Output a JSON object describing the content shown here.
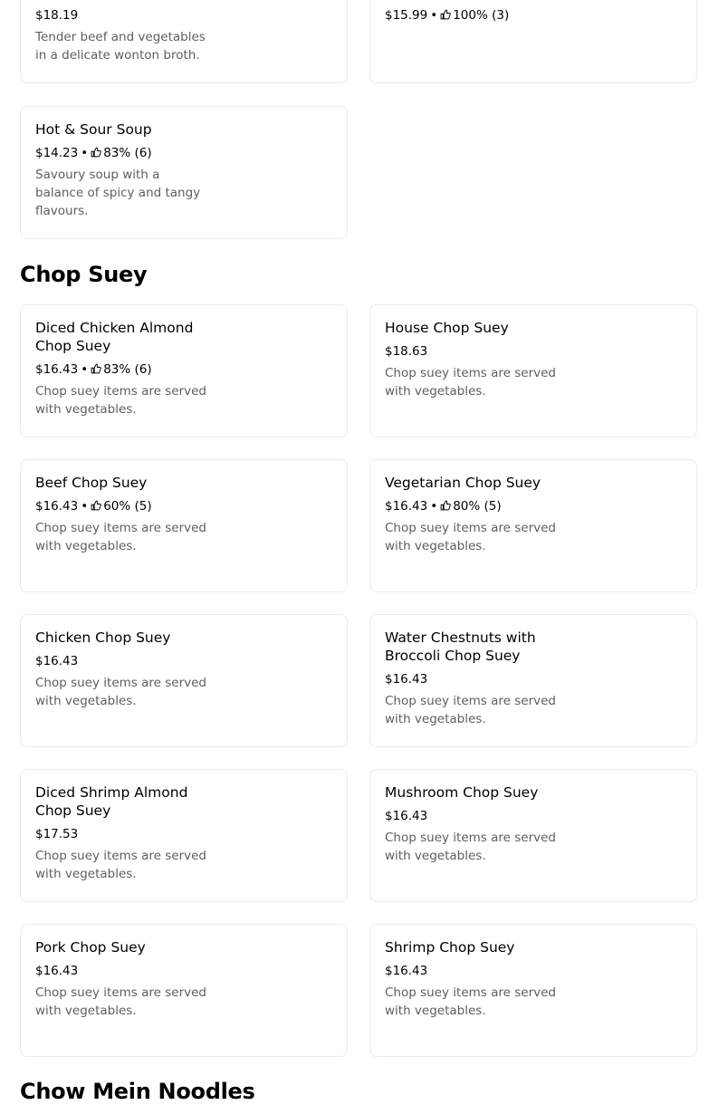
{
  "top_items": [
    {
      "price": "$18.19",
      "description": "Tender beef and vegetables in a delicate wonton broth."
    },
    {
      "price": "$15.99",
      "rating": "100% (3)"
    }
  ],
  "soup_items": [
    {
      "name": "Hot & Sour Soup",
      "price": "$14.23",
      "rating": "83% (6)",
      "description": "Savoury soup with a balance of spicy and tangy flavours."
    }
  ],
  "chop_suey": {
    "title": "Chop Suey",
    "items": [
      {
        "name": "Diced Chicken Almond Chop Suey",
        "price": "$16.43",
        "rating": "83% (6)",
        "description": "Chop suey items are served with vegetables."
      },
      {
        "name": "House Chop Suey",
        "price": "$18.63",
        "description": "Chop suey items are served with vegetables."
      },
      {
        "name": "Beef Chop Suey",
        "price": "$16.43",
        "rating": "60% (5)",
        "description": "Chop suey items are served with vegetables."
      },
      {
        "name": "Vegetarian Chop Suey",
        "price": "$16.43",
        "rating": "80% (5)",
        "description": "Chop suey items are served with vegetables."
      },
      {
        "name": "Chicken Chop Suey",
        "price": "$16.43",
        "description": "Chop suey items are served with vegetables."
      },
      {
        "name": "Water Chestnuts with Broccoli Chop Suey",
        "price": "$16.43",
        "description": "Chop suey items are served with vegetables."
      },
      {
        "name": "Diced Shrimp Almond Chop Suey",
        "price": "$17.53",
        "description": "Chop suey items are served with vegetables."
      },
      {
        "name": "Mushroom Chop Suey",
        "price": "$16.43",
        "description": "Chop suey items are served with vegetables."
      },
      {
        "name": "Pork Chop Suey",
        "price": "$16.43",
        "description": "Chop suey items are served with vegetables."
      },
      {
        "name": "Shrimp Chop Suey",
        "price": "$16.43",
        "description": "Chop suey items are served with vegetables."
      }
    ]
  },
  "next_section": {
    "title": "Chow Mein Noodles"
  },
  "icons": {
    "rating": "thumbs-up-icon"
  },
  "colors": {
    "text": "#000000",
    "muted": "#5e5e5e",
    "border": "#ebebeb"
  }
}
